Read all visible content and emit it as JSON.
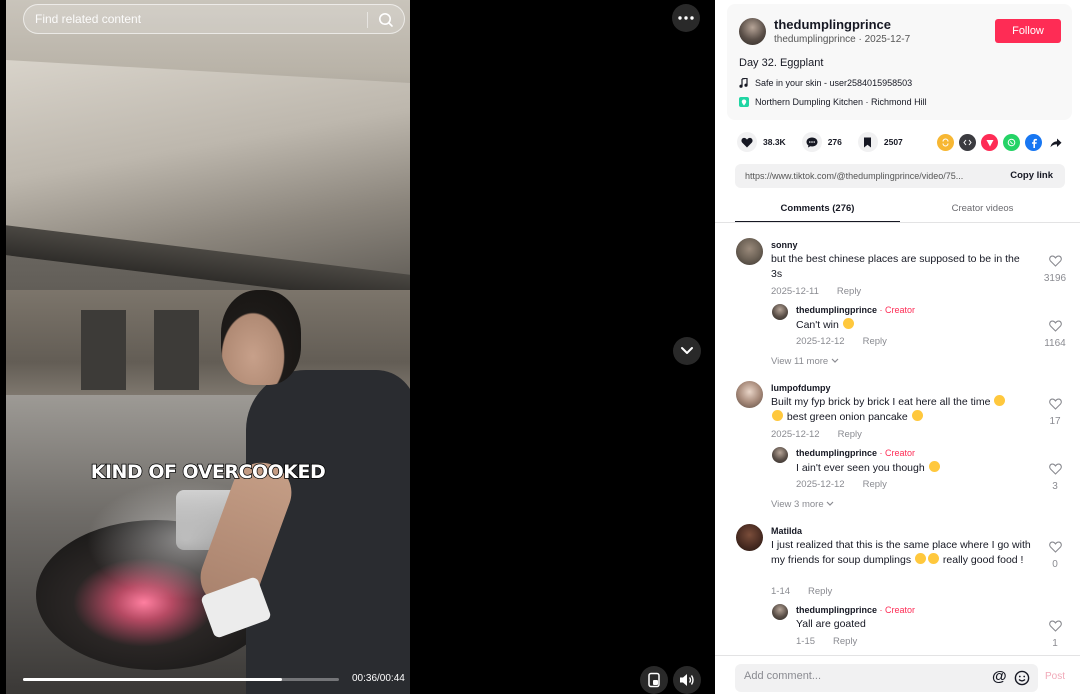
{
  "search": {
    "placeholder": "Find related content"
  },
  "video": {
    "caption": "KIND OF OVERCOOKED",
    "time_display": "00:36/00:44",
    "progress_fraction": 0.82
  },
  "author": {
    "name": "thedumplingprince",
    "handle_date": "thedumplingprince · 2025-12-7",
    "follow_label": "Follow"
  },
  "post": {
    "description": "Day 32. Eggplant",
    "music": "Safe in your skin - user2584015958503",
    "location": "Northern Dumpling Kitchen · Richmond Hill"
  },
  "actions": {
    "likes": "38.3K",
    "comments": "276",
    "saves": "2507"
  },
  "link": {
    "url": "https://www.tiktok.com/@thedumplingprince/video/75...",
    "copy_label": "Copy link"
  },
  "tabs": {
    "comments": "Comments (276)",
    "creator": "Creator videos"
  },
  "comments": [
    {
      "user": "sonny",
      "text": "but the best chinese places are supposed to be in the 3s",
      "date": "2025-12-11",
      "reply_label": "Reply",
      "likes": "3196",
      "creator_reply": {
        "user": "thedumplingprince",
        "badge": "· Creator",
        "text": "Can't win",
        "date": "2025-12-12",
        "reply_label": "Reply",
        "likes": "1164"
      },
      "view_more": "View 11 more"
    },
    {
      "user": "lumpofdumpy",
      "text": "Built my fyp brick by brick I eat here all the time",
      "text2": "best green onion pancake",
      "date": "2025-12-12",
      "reply_label": "Reply",
      "likes": "17",
      "creator_reply": {
        "user": "thedumplingprince",
        "badge": "· Creator",
        "text": "I ain't ever seen you though",
        "date": "2025-12-12",
        "reply_label": "Reply",
        "likes": "3"
      },
      "view_more": "View 3 more"
    },
    {
      "user": "Matilda",
      "text": "I just realized that this is the same place where I go with my friends for soup dumplings",
      "text2": "really good food !",
      "date": "1-14",
      "reply_label": "Reply",
      "likes": "0",
      "creator_reply": {
        "user": "thedumplingprince",
        "badge": "· Creator",
        "text": "Yall are goated",
        "date": "1-15",
        "reply_label": "Reply",
        "likes": "1"
      }
    }
  ],
  "composer": {
    "placeholder": "Add comment...",
    "at_symbol": "@",
    "post_label": "Post"
  },
  "colors": {
    "accent": "#fe2c55",
    "location_icon": "#20d5a3"
  },
  "icons": [
    "search-icon",
    "more-icon",
    "chevron-down-icon",
    "pip-icon",
    "volume-icon",
    "heart-icon",
    "comment-icon",
    "bookmark-icon",
    "music-note-icon",
    "location-icon",
    "emoji-icon"
  ]
}
